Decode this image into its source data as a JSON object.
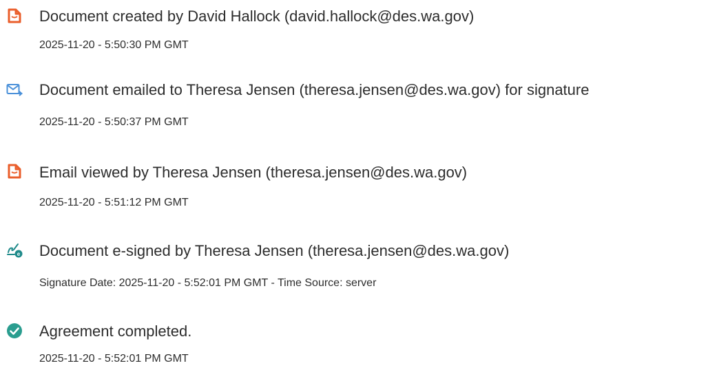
{
  "audit": {
    "entries": [
      {
        "icon": "document-created-icon",
        "title": "Document created by David Hallock (david.hallock@des.wa.gov)",
        "timestamp": "2025-11-20 - 5:50:30 PM GMT"
      },
      {
        "icon": "email-sent-icon",
        "title": "Document emailed to Theresa Jensen (theresa.jensen@des.wa.gov) for signature",
        "timestamp": "2025-11-20 - 5:50:37 PM GMT"
      },
      {
        "icon": "document-viewed-icon",
        "title": "Email viewed by Theresa Jensen (theresa.jensen@des.wa.gov)",
        "timestamp": "2025-11-20 - 5:51:12 PM GMT"
      },
      {
        "icon": "e-sign-icon",
        "title": "Document e-signed by Theresa Jensen (theresa.jensen@des.wa.gov)",
        "timestamp": "Signature Date: 2025-11-20 - 5:52:01 PM GMT - Time Source: server"
      },
      {
        "icon": "check-circle-icon",
        "title": "Agreement completed.",
        "timestamp": "2025-11-20 - 5:52:01 PM GMT"
      }
    ]
  },
  "colors": {
    "text": "#2c2c2c",
    "doc_icon": "#ea5e2b",
    "email_icon": "#4a90d9",
    "sign_icon": "#1f8a8a",
    "check_icon": "#2a9d8f"
  }
}
